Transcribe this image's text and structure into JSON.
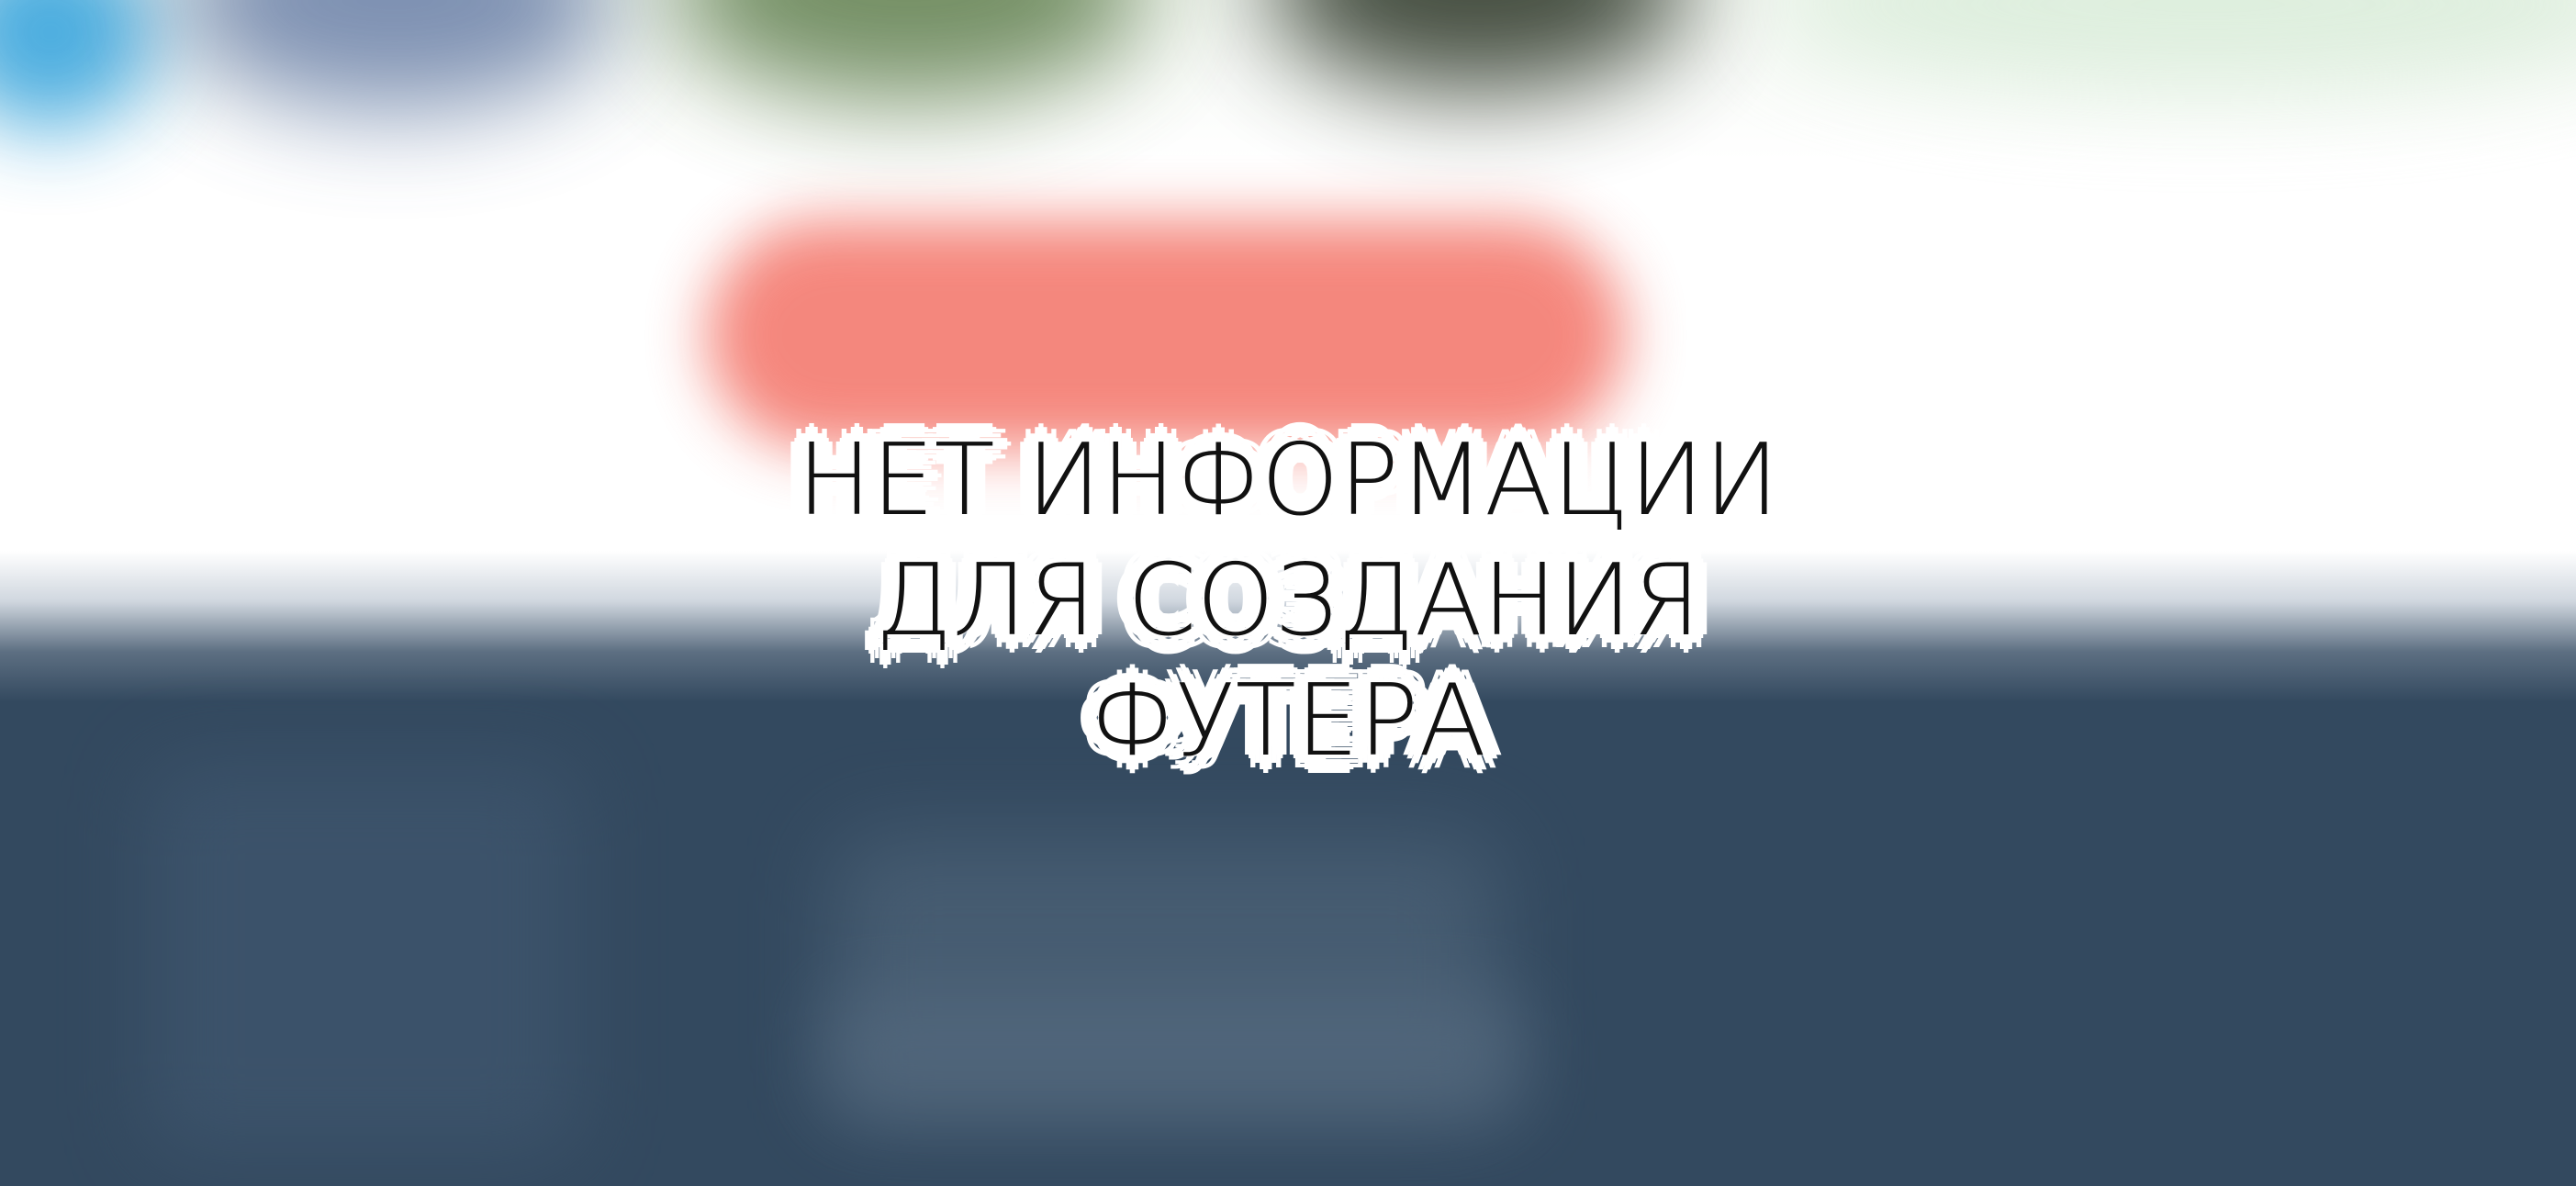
{
  "message": {
    "line1": "НЕТ ИНФОРМАЦИИ",
    "line2": "ДЛЯ СОЗДАНИЯ",
    "line3": "ФУТЕРА"
  },
  "colors": {
    "background": "#ffffff",
    "cta_blur": "#f47d72",
    "footer": "#33495f",
    "text": "#111111",
    "text_outline": "#ffffff"
  }
}
